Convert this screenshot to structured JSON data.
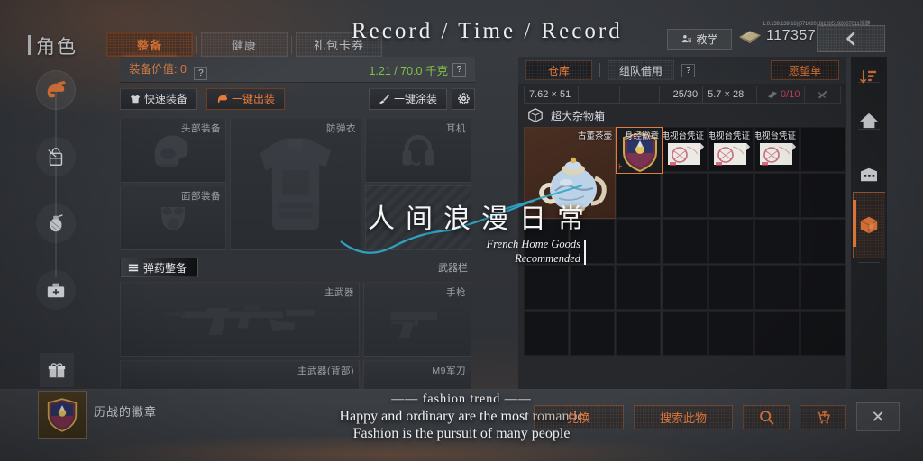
{
  "header": {
    "character_label": "角色",
    "tabs": [
      {
        "label": "整备",
        "active": true
      },
      {
        "label": "健康",
        "active": false
      },
      {
        "label": "礼包卡券",
        "active": false
      }
    ],
    "record_title": "Record / Time / Record",
    "tutorial_label": "教学",
    "money": "117357",
    "version": "1.0.139.139(16)|07102018|1285192607011浣濋",
    "back_icon": "chevron-left-icon"
  },
  "left_rail": {
    "items": [
      {
        "icon": "helmet-icon",
        "selected": true
      },
      {
        "icon": "backpack-icon",
        "selected": false
      },
      {
        "icon": "grenade-icon",
        "selected": false
      },
      {
        "icon": "medkit-icon",
        "selected": false
      }
    ],
    "gift_icon": "gift-icon"
  },
  "loadout": {
    "value_label": "装备价值:",
    "value_number": "0",
    "weight": "1.21 / 70.0 千克",
    "help_mark": "?",
    "actions": [
      {
        "label": "快速装备",
        "icon": "shirt-icon",
        "style": "normal"
      },
      {
        "label": "一键出装",
        "icon": "gear-orange-icon",
        "style": "orange"
      },
      {
        "label": "一键涂装",
        "icon": "brush-icon",
        "style": "normal"
      }
    ],
    "gear_icon": "gear-icon",
    "slots": [
      {
        "label": "头部装备",
        "ghost": "helmet"
      },
      {
        "label": "防弹衣",
        "ghost": "vest"
      },
      {
        "label": "耳机",
        "ghost": "headset"
      },
      {
        "label": "面部装备",
        "ghost": "mask"
      },
      {
        "label": "",
        "ghost": "none"
      }
    ],
    "ammo_section": {
      "tag_label": "弹药整备",
      "tag_icon": "ammo-icon",
      "right_label": "武器栏"
    },
    "weapon_slots": [
      {
        "label": "主武器",
        "ghost": "rifle"
      },
      {
        "label": "手枪",
        "ghost": "pistol"
      },
      {
        "label": "主武器(背部)",
        "ghost": "none"
      },
      {
        "label": "M9军刀",
        "ghost": "none"
      }
    ]
  },
  "inventory": {
    "tabs": [
      {
        "label": "仓库",
        "active": true
      },
      {
        "label": "组队借用",
        "active": false
      }
    ],
    "help_mark": "?",
    "wishlist_label": "愿望单",
    "sort_icon": "sort-icon",
    "ammo_row": [
      {
        "text": "7.62 × 51"
      },
      {
        "text": ""
      },
      {
        "text": ""
      },
      {
        "text": "25/30"
      },
      {
        "text": "5.7 × 28"
      },
      {
        "text": "0/10"
      },
      {
        "text": ""
      }
    ],
    "container": {
      "icon": "box-icon",
      "name": "超大杂物箱"
    },
    "items": [
      {
        "name": "古董茶壶",
        "kind": "teapot",
        "selected": false
      },
      {
        "name": "身经徽章",
        "kind": "badge",
        "selected": true
      },
      {
        "name": "电视台凭证",
        "kind": "pass",
        "selected": false
      },
      {
        "name": "电视台凭证",
        "kind": "pass",
        "selected": false
      },
      {
        "name": "电视台凭证",
        "kind": "pass",
        "selected": false
      }
    ]
  },
  "right_rail": {
    "items": [
      {
        "icon": "sort-icon",
        "selected": false
      },
      {
        "icon": "home-icon",
        "selected": false
      },
      {
        "icon": "stash-icon",
        "selected": false
      },
      {
        "icon": "crate-icon",
        "selected": true
      }
    ]
  },
  "watermark": {
    "chinese": "人间浪漫日常",
    "english_line1": "French Home Goods",
    "english_line2": "Recommended"
  },
  "bottom": {
    "tip_item_name": "历战的徽章",
    "tip_item_icon": "badge-icon",
    "fashion_line1": "——  fashion trend  ——",
    "fashion_line2": "Happy and ordinary are the most romantic",
    "fashion_line3": "Fashion is the pursuit of many people",
    "actions": [
      {
        "label": "兑换",
        "kind": "text"
      },
      {
        "label": "搜索此物",
        "kind": "text"
      },
      {
        "label": "",
        "kind": "search-icon"
      },
      {
        "label": "",
        "kind": "sell-icon"
      },
      {
        "label": "✕",
        "kind": "close-icon"
      }
    ]
  },
  "colors": {
    "accent": "#e87b3c",
    "green": "#7fc24a",
    "panel": "#26282c"
  }
}
